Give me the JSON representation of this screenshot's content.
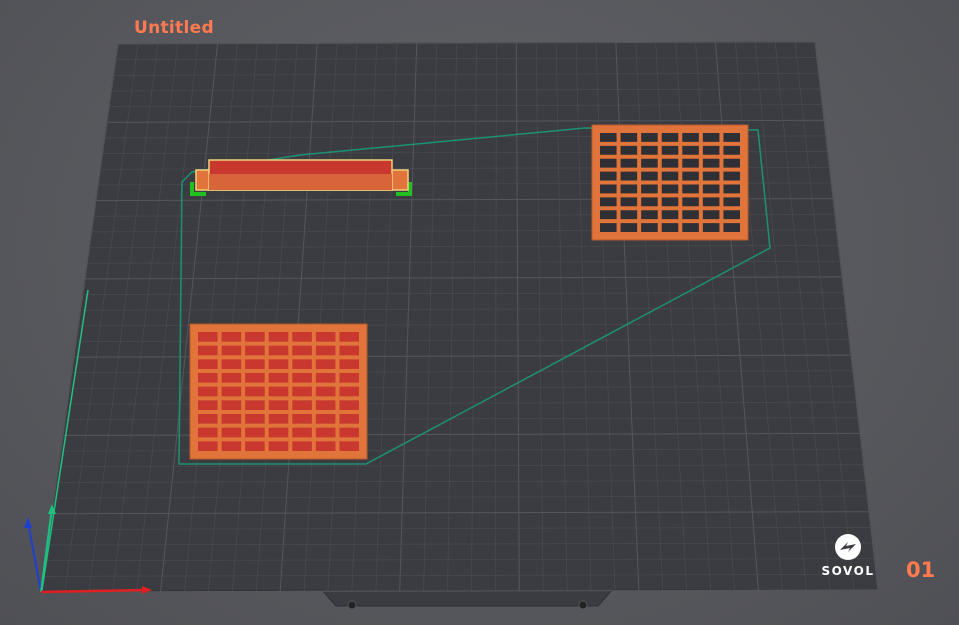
{
  "app": {
    "plate_title": "Untitled",
    "plate_number": "01",
    "brand": "SOVOL"
  },
  "colors": {
    "background": "#5a5b60",
    "bed": "#3b3c42",
    "grid_minor": "#4a4b51",
    "grid_major": "#55565c",
    "model_orange": "#e0743a",
    "model_red": "#c9382e",
    "model_outline": "#f3d17a",
    "skirt": "#1a9a7a",
    "selection_green": "#20c020",
    "axis_x": "#e02020",
    "axis_y": "#20c080",
    "axis_z": "#1f3fd0",
    "accent": "#ff7a50"
  },
  "objects": [
    {
      "name": "long-bar",
      "label": ""
    },
    {
      "name": "grid-tile-left",
      "label": ""
    },
    {
      "name": "grid-tile-right",
      "label": ""
    }
  ]
}
